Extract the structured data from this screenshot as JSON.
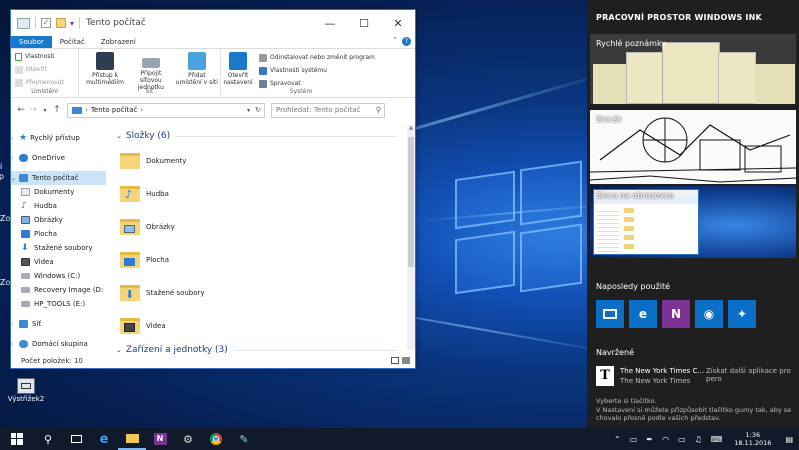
{
  "explorer": {
    "title": "Tento počítač",
    "ribbon_tabs": [
      "Soubor",
      "Počítač",
      "Zobrazení"
    ],
    "groups": {
      "location": {
        "label": "Umístění",
        "items": [
          "Vlastnosti",
          "Otevřít",
          "Přejmenovat"
        ]
      },
      "network": {
        "label": "Síť",
        "items": [
          "Přístup k multimédiím",
          "Připojit síťovou jednotku",
          "Přidat umístění v síti"
        ]
      },
      "system": {
        "label": "Systém",
        "open_settings": "Otevřít nastavení",
        "items": [
          "Odinstalovat nebo změnit program",
          "Vlastnosti systému",
          "Spravovat"
        ]
      }
    },
    "address": "Tento počítač",
    "search_placeholder": "Prohledat: Tento počítač",
    "nav": [
      "Rychlý přístup",
      "OneDrive",
      "Tento počítač",
      "Dokumenty",
      "Hudba",
      "Obrázky",
      "Plocha",
      "Stažené soubory",
      "Videa",
      "Windows (C:)",
      "Recovery Image (D:",
      "HP_TOOLS (E:)",
      "Síť",
      "Domácí skupina"
    ],
    "folders_header": "Složky (6)",
    "folders": [
      "Dokumenty",
      "Hudba",
      "Obrázky",
      "Plocha",
      "Stažené soubory",
      "Videa"
    ],
    "devices_header": "Zařízení a jednotky (3)",
    "status": "Počet položek: 10"
  },
  "desktop": {
    "icon_label": "Výstřižek2",
    "partial_labels": [
      "Ni",
      "op",
      "Zo",
      "Zo"
    ]
  },
  "ink": {
    "title": "PRACOVNÍ PROSTOR WINDOWS INK",
    "sticky_notes": "Rychlé poznámky",
    "sketchpad": "Skicák",
    "screen_sketch": "Skica na obrazovce",
    "recent_title": "Naposledy použité",
    "recent_apps": [
      {
        "icon": "photos-icon",
        "color": "#0b6fc7"
      },
      {
        "icon": "edge-icon",
        "color": "#0b6fc7"
      },
      {
        "icon": "onenote-icon",
        "color": "#7c3294"
      },
      {
        "icon": "maps-icon",
        "color": "#0b6fc7"
      },
      {
        "icon": "tips-icon",
        "color": "#0b6fc7"
      }
    ],
    "suggested_title": "Navržené",
    "suggested_name": "The New York Times C...",
    "suggested_publisher": "The New York Times",
    "suggested_hint": "Získat další aplikace pro pero",
    "footer": "Vyberte si tlačítko.\nV Nastavení si můžete přizpůsobit tlačítko gumy tak, aby se chovalo přesně podle vašich představ."
  },
  "taskbar": {
    "time": "1:36",
    "date": "18.11.2016"
  }
}
